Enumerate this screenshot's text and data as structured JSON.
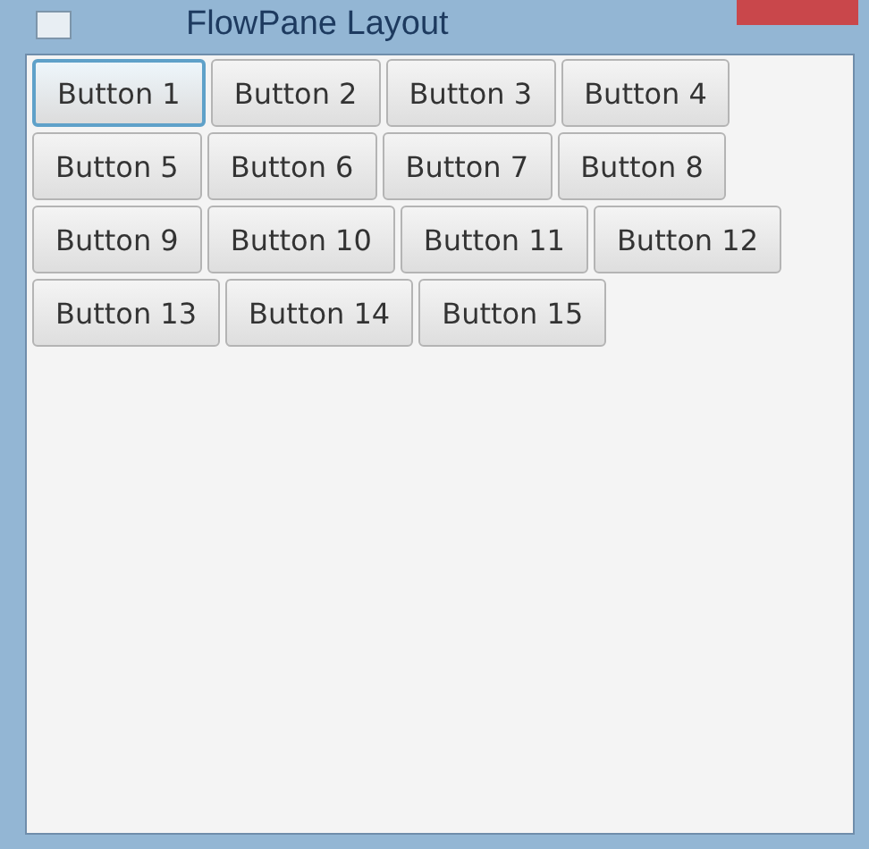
{
  "window": {
    "title": "FlowPane Layout"
  },
  "buttons": [
    {
      "label": "Button 1",
      "focused": true
    },
    {
      "label": "Button 2",
      "focused": false
    },
    {
      "label": "Button 3",
      "focused": false
    },
    {
      "label": "Button 4",
      "focused": false
    },
    {
      "label": "Button 5",
      "focused": false
    },
    {
      "label": "Button 6",
      "focused": false
    },
    {
      "label": "Button 7",
      "focused": false
    },
    {
      "label": "Button 8",
      "focused": false
    },
    {
      "label": "Button 9",
      "focused": false
    },
    {
      "label": "Button 10",
      "focused": false
    },
    {
      "label": "Button 11",
      "focused": false
    },
    {
      "label": "Button 12",
      "focused": false
    },
    {
      "label": "Button 13",
      "focused": false
    },
    {
      "label": "Button 14",
      "focused": false
    },
    {
      "label": "Button 15",
      "focused": false
    }
  ]
}
